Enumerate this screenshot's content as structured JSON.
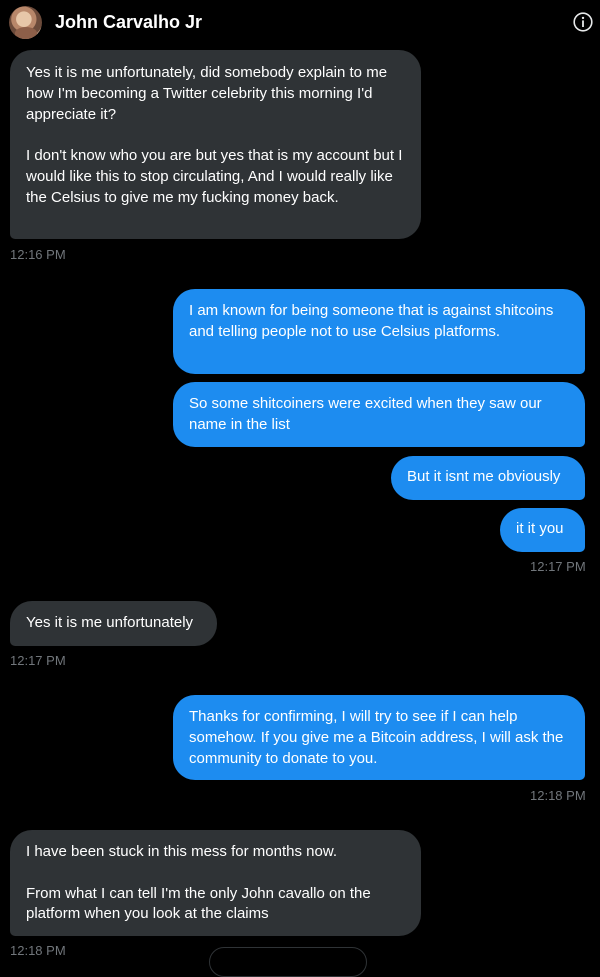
{
  "header": {
    "contact_name": "John Carvalho Jr",
    "info_icon": "info-icon",
    "avatar_icon": "avatar"
  },
  "messages": [
    {
      "direction": "incoming",
      "text": "Yes it is me unfortunately, did somebody explain to me how I'm becoming a Twitter celebrity this morning I'd appreciate it?\n\nI don't know who you are but yes that is my account but I would like this to stop circulating, And I would really like the Celsius to give me my fucking money back.",
      "time": "12:16 PM"
    },
    {
      "direction": "outgoing",
      "text": "I am known for being someone that is against shitcoins and telling people not to use Celsius platforms."
    },
    {
      "direction": "outgoing",
      "text": "So some shitcoiners were excited when they saw our name in the list"
    },
    {
      "direction": "outgoing",
      "text": "But it isnt me obviously"
    },
    {
      "direction": "outgoing",
      "text": "it it you",
      "time": "12:17 PM"
    },
    {
      "direction": "incoming",
      "text": "Yes it is me unfortunately",
      "time": "12:17 PM"
    },
    {
      "direction": "outgoing",
      "text": "Thanks for confirming, I will try to see if I can help somehow. If you give me a Bitcoin address, I will ask the community to donate to you.",
      "time": "12:18 PM"
    },
    {
      "direction": "incoming",
      "text": "I have been stuck in this mess for months now.\n\nFrom what I can tell I'm the only John cavallo on the platform when you look at the claims",
      "time": "12:18 PM"
    }
  ],
  "colors": {
    "background": "#000000",
    "incoming_bubble": "#2f3336",
    "outgoing_bubble": "#1d8cf0",
    "timestamp": "#71767b",
    "text": "#ffffff"
  }
}
